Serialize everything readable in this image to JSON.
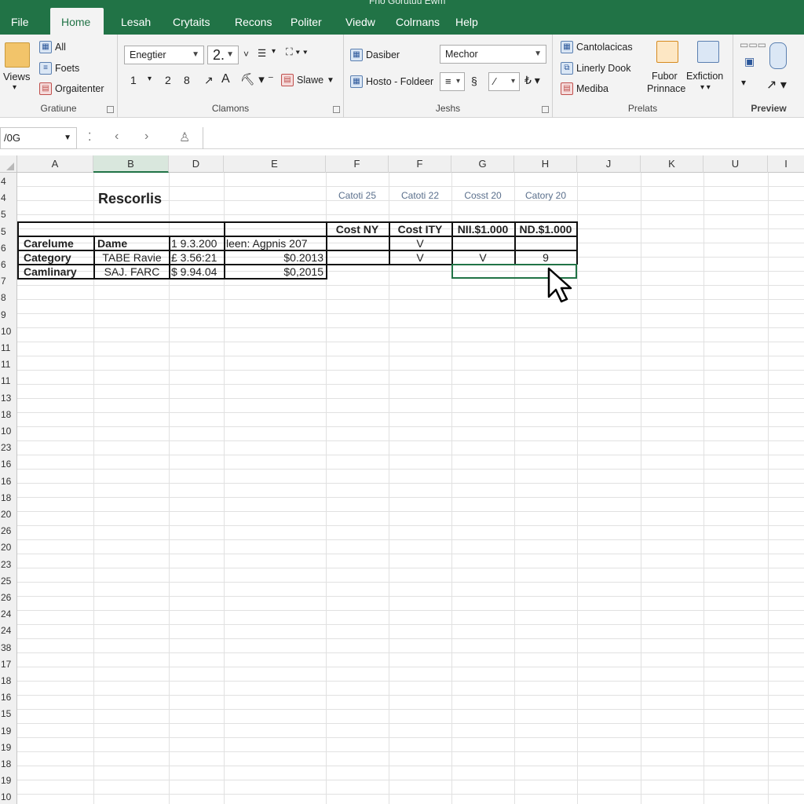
{
  "window": {
    "title": "Fno Gorutuu Ewm",
    "accent": "#217346"
  },
  "tabs": [
    "File",
    "Home",
    "Lesah",
    "Crytaits",
    "Recons",
    "Politer",
    "Viedw",
    "Colrnans",
    "Help"
  ],
  "active_tab": "Home",
  "ribbon": {
    "views_label": "Views",
    "g1": {
      "all": "All",
      "foets": "Foets",
      "organizer": "Orgaitenter",
      "label": "Gratiune"
    },
    "g2": {
      "font": "Enegtier",
      "size": "2.",
      "swave": "Slawe",
      "label": "Clamons"
    },
    "g3": {
      "dasiber": "Dasiber",
      "hoste": "Hosto - Foldeer",
      "mechor": "Mechor",
      "label": "Jeshs"
    },
    "g4": {
      "cantolacicas": "Cantolacicas",
      "linerly": "Linerly Dook",
      "mediba": "Mediba",
      "fubor": "Fubor",
      "prinnace": "Prinnace",
      "extiction": "Exfiction",
      "label": "Prelats"
    },
    "g5": {
      "label": "Preview"
    }
  },
  "formula_bar": {
    "name_box": "/0G",
    "content": ""
  },
  "columns": [
    "A",
    "B",
    "D",
    "E",
    "F",
    "F",
    "G",
    "H",
    "J",
    "K",
    "U",
    "I"
  ],
  "rows": [
    "4",
    "4",
    "5",
    "5",
    "6",
    "6",
    "7",
    "8",
    "9",
    "10",
    "11",
    "11",
    "11",
    "13",
    "18",
    "10",
    "23",
    "16",
    "16",
    "18",
    "20",
    "26",
    "20",
    "23",
    "25",
    "26",
    "24",
    "24",
    "38",
    "17",
    "18",
    "16",
    "15",
    "19",
    "19",
    "18",
    "19",
    "10"
  ],
  "sheet": {
    "title": "Rescorlis",
    "top_labels": [
      "Catoti 25",
      "Catoti 22",
      "Cosst 20",
      "Catory 20"
    ],
    "header": [
      "Cost NY",
      "Cost ITY",
      "NII.$1.000",
      "ND.$1.000"
    ],
    "r1": {
      "a": "Carelume",
      "b": "Dame",
      "d": "1 9.3.200",
      "e": "leen: Agpnis  207",
      "g": "V"
    },
    "r2": {
      "a": "Category",
      "b": "TABE  Ravie",
      "d": "£ 3.56:21",
      "e": "$0.2013",
      "g": "V",
      "h": "V",
      "i": "9"
    },
    "r3": {
      "a": "Camlinary",
      "b": "SAJ.  FARC",
      "d": "$ 9.94.04",
      "e": "$0,2015"
    }
  }
}
